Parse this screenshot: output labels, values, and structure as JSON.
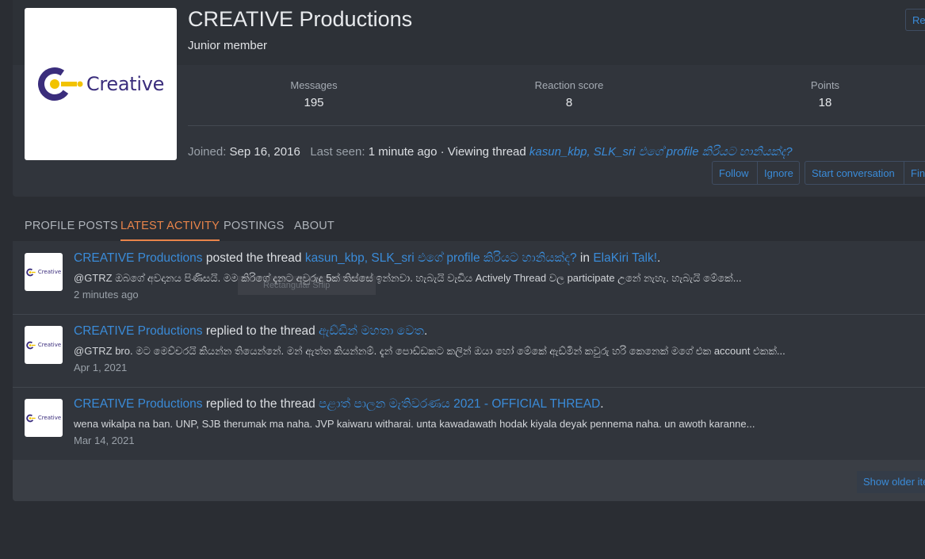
{
  "profile": {
    "username": "CREATIVE Productions",
    "user_title": "Junior member",
    "avatar_logo_text": "Creative",
    "report_label": "Report",
    "stats": [
      {
        "label": "Messages",
        "value": "195"
      },
      {
        "label": "Reaction score",
        "value": "8"
      },
      {
        "label": "Points",
        "value": "18"
      }
    ],
    "joined_label": "Joined:",
    "joined_value": "Sep 16, 2016",
    "last_seen_label": "Last seen:",
    "last_seen_value": "1 minute ago · Viewing thread",
    "viewing_thread": "kasun_kbp, SLK_sri එගේ profile කිරියට හානියක්ද?",
    "buttons": {
      "follow": "Follow",
      "ignore": "Ignore",
      "start_conversation": "Start conversation",
      "find": "Find"
    }
  },
  "tabs": [
    {
      "label": "PROFILE POSTS",
      "active": false
    },
    {
      "label": "LATEST ACTIVITY",
      "active": true
    },
    {
      "label": "POSTINGS",
      "active": false
    },
    {
      "label": "ABOUT",
      "active": false
    }
  ],
  "activity": [
    {
      "user": "CREATIVE Productions",
      "action": "posted the thread",
      "thread": "kasun_kbp, SLK_sri එගේ profile කිරියට හානියක්ද?",
      "in_label": "in",
      "forum": "ElaKiri Talk!",
      "end": ".",
      "snippet": "@GTRZ ඔබගේ අවදානය පිණිසයි. මම කිරිගේ දැනට අවුරුදු 5ක් තිස්සේ ඉන්නවා. හැබැයි වැඩිය Actively Thread වල participate උනේ නැහැ. හැබැයි මේකේ...",
      "date": "2 minutes ago"
    },
    {
      "user": "CREATIVE Productions",
      "action": "replied to the thread",
      "thread": "ඇඩ්ඩින් මහතා වෙත",
      "end": ".",
      "snippet": "@GTRZ bro. මට මෙච්චරයි කියන්න තියෙන්නේ. මන් ඇත්ත කියන්නම්. දැන් පොඩ්ඩකට කලින් ඔයා හෝ මේකේ ඇඩ්මින් කවුරු හරි කෙනෙක් මගේ එක account එකක්...",
      "date": "Apr 1, 2021"
    },
    {
      "user": "CREATIVE Productions",
      "action": "replied to the thread",
      "thread": "පළාත් පාලන මැතිවරණය 2021 - OFFICIAL THREAD",
      "end": ".",
      "snippet": "wena wikalpa na ban. UNP, SJB therumak ma naha. JVP kaiwaru witharai. unta kawadawath hodak kiyala deyak pennema naha. un awoth karanne...",
      "date": "Mar 14, 2021"
    }
  ],
  "show_older": "Show older items",
  "ghost_label": "Rectangular Snip"
}
